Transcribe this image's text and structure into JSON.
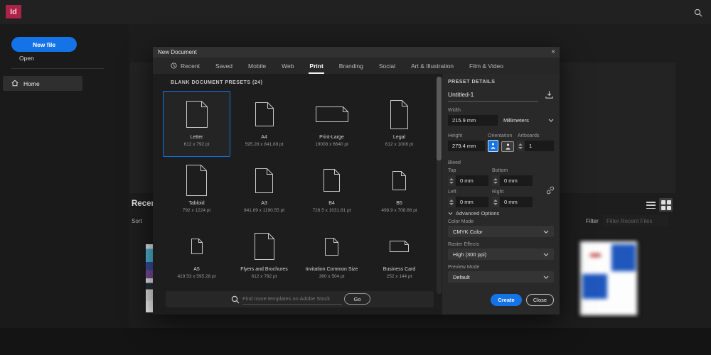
{
  "topbar": {
    "logo": "Id"
  },
  "sidebar": {
    "new_file": "New file",
    "open": "Open",
    "home": "Home"
  },
  "home": {
    "recent": "Recent",
    "sort": "Sort",
    "filter": "Filter",
    "filter_placeholder": "Filter Recent Files"
  },
  "dialog": {
    "title": "New Document",
    "close_x": "×",
    "tabs": [
      {
        "label": "Recent",
        "icon": "clock",
        "active": false
      },
      {
        "label": "Saved",
        "active": false
      },
      {
        "label": "Mobile",
        "active": false
      },
      {
        "label": "Web",
        "active": false
      },
      {
        "label": "Print",
        "active": true
      },
      {
        "label": "Branding",
        "active": false
      },
      {
        "label": "Social",
        "active": false
      },
      {
        "label": "Art & Illustration",
        "active": false
      },
      {
        "label": "Film & Video",
        "active": false
      }
    ],
    "presets_heading": "BLANK DOCUMENT PRESETS (24)",
    "presets": [
      {
        "name": "Letter",
        "size": "612 x 792 pt",
        "selected": true,
        "iw": 30,
        "ih": 38
      },
      {
        "name": "A4",
        "size": "595.28 x 841.89 pt",
        "selected": false,
        "iw": 26,
        "ih": 34
      },
      {
        "name": "Print-Large",
        "size": "19008 x 6640 pt",
        "selected": false,
        "iw": 46,
        "ih": 22
      },
      {
        "name": "Legal",
        "size": "612 x 1008 pt",
        "selected": false,
        "iw": 25,
        "ih": 41
      },
      {
        "name": "Tabloid",
        "size": "792 x 1224 pt",
        "selected": false,
        "iw": 29,
        "ih": 44
      },
      {
        "name": "A3",
        "size": "841.89 x 1190.55 pt",
        "selected": false,
        "iw": 25,
        "ih": 35
      },
      {
        "name": "B4",
        "size": "728.5 x 1031.81 pt",
        "selected": false,
        "iw": 23,
        "ih": 32
      },
      {
        "name": "B5",
        "size": "498.9 x 708.66 pt",
        "selected": false,
        "iw": 19,
        "ih": 27
      },
      {
        "name": "A5",
        "size": "419.53 x 595.28 pt",
        "selected": false,
        "iw": 16,
        "ih": 22
      },
      {
        "name": "Flyers and Brochures",
        "size": "612 x 792 pt",
        "selected": false,
        "iw": 28,
        "ih": 38
      },
      {
        "name": "Invitation Common Size",
        "size": "360 x 504 pt",
        "selected": false,
        "iw": 19,
        "ih": 25
      },
      {
        "name": "Business Card",
        "size": "252 x 144 pt",
        "selected": false,
        "iw": 27,
        "ih": 16
      }
    ],
    "stock_search": {
      "placeholder": "Find more templates on Adobe Stock",
      "go": "Go"
    },
    "details": {
      "heading": "PRESET DETAILS",
      "name_value": "Untitled-1",
      "width_label": "Width",
      "width_value": "215.9 mm",
      "units_value": "Millimeters",
      "height_label": "Height",
      "height_value": "279.4 mm",
      "orientation_label": "Orientation",
      "artboards_label": "Artboards",
      "artboards_value": "1",
      "bleed_label": "Bleed",
      "bleed_fields": [
        {
          "label": "Top",
          "value": "0 mm"
        },
        {
          "label": "Bottom",
          "value": "0 mm"
        },
        {
          "label": "Left",
          "value": "0 mm"
        },
        {
          "label": "Right",
          "value": "0 mm"
        }
      ],
      "advanced_label": "Advanced Options",
      "color_mode_label": "Color Mode",
      "color_mode_value": "CMYK Color",
      "raster_label": "Raster Effects",
      "raster_value": "High (300 ppi)",
      "preview_label": "Preview Mode",
      "preview_value": "Default",
      "create": "Create",
      "close": "Close"
    }
  },
  "colors": {
    "accent": "#1473e6",
    "logo_bg": "#ab2346",
    "logo_fg": "#ffccd9",
    "doc_icon_stroke": "#c9c9c9"
  }
}
